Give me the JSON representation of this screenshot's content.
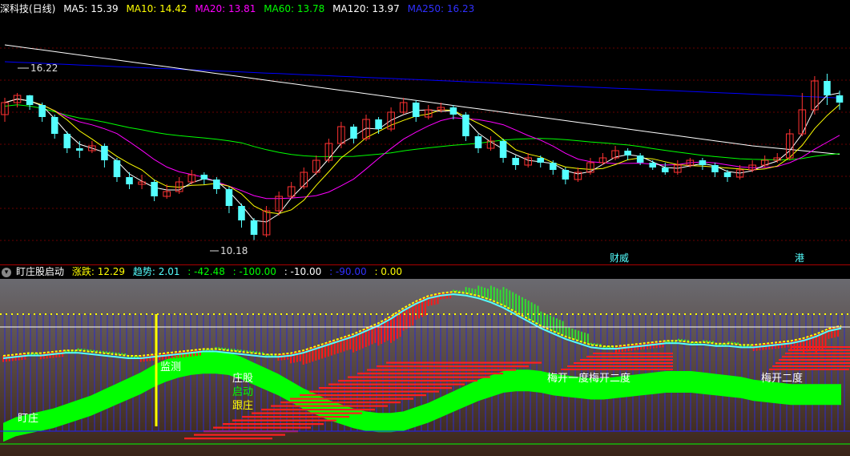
{
  "header_main": {
    "title": "深科技(日线)",
    "ma5": "MA5: 15.39",
    "ma10": "MA10: 14.42",
    "ma20": "MA20: 13.81",
    "ma60": "MA60: 13.78",
    "ma120": "MA120: 13.97",
    "ma250": "MA250: 16.23"
  },
  "header_sub": {
    "title": "盯庄股启动",
    "zhangdie": "涨跌: 12.29",
    "qushi": "趋势: 2.01",
    "v1": ": -42.48",
    "v2": ": -100.00",
    "v3": ": -10.00",
    "v4": ": -90.00",
    "v5": ": 0.00"
  },
  "colors": {
    "ma5": "#ffffff",
    "ma10": "#ffff00",
    "ma20": "#ff00ff",
    "ma60": "#00ff00",
    "ma120": "#ffffff",
    "ma250": "#0000ff",
    "up": "#ff3232",
    "down": "#54ffff"
  },
  "chart_data": [
    {
      "type": "candlestick",
      "high_label": "16.22",
      "low_label": "10.18",
      "ylim": [
        9.5,
        19.5
      ],
      "events": [
        "财威",
        "港"
      ],
      "candles": [
        [
          15.4,
          15.9,
          15.1,
          16.1
        ],
        [
          15.9,
          16.2,
          15.7,
          16.3
        ],
        [
          16.2,
          15.8,
          15.6,
          16.22
        ],
        [
          15.8,
          15.3,
          15.1,
          15.9
        ],
        [
          15.3,
          14.6,
          14.4,
          15.4
        ],
        [
          14.6,
          14.0,
          13.8,
          14.7
        ],
        [
          14.0,
          13.9,
          13.6,
          14.3
        ],
        [
          13.9,
          14.1,
          13.8,
          14.3
        ],
        [
          14.1,
          13.5,
          13.2,
          14.2
        ],
        [
          13.5,
          12.8,
          12.6,
          13.6
        ],
        [
          12.8,
          12.5,
          12.3,
          13.0
        ],
        [
          12.5,
          12.6,
          12.3,
          12.9
        ],
        [
          12.6,
          12.0,
          11.8,
          12.7
        ],
        [
          12.0,
          12.2,
          11.9,
          12.5
        ],
        [
          12.2,
          12.6,
          12.1,
          12.8
        ],
        [
          12.6,
          12.9,
          12.5,
          13.1
        ],
        [
          12.9,
          12.7,
          12.5,
          13.0
        ],
        [
          12.7,
          12.3,
          12.1,
          12.8
        ],
        [
          12.3,
          11.6,
          11.3,
          12.4
        ],
        [
          11.6,
          11.0,
          10.7,
          11.7
        ],
        [
          11.0,
          10.4,
          10.18,
          11.1
        ],
        [
          10.4,
          11.4,
          10.3,
          11.6
        ],
        [
          11.4,
          12.0,
          11.2,
          12.2
        ],
        [
          12.0,
          12.4,
          11.9,
          12.6
        ],
        [
          12.4,
          13.0,
          12.3,
          13.2
        ],
        [
          13.0,
          13.5,
          12.9,
          13.7
        ],
        [
          13.5,
          14.2,
          13.4,
          14.4
        ],
        [
          14.2,
          14.9,
          14.0,
          15.1
        ],
        [
          14.9,
          14.4,
          14.2,
          15.0
        ],
        [
          14.4,
          15.2,
          14.3,
          15.4
        ],
        [
          15.2,
          14.8,
          14.6,
          15.3
        ],
        [
          14.8,
          15.5,
          14.7,
          15.7
        ],
        [
          15.5,
          15.9,
          15.4,
          16.1
        ],
        [
          15.9,
          15.3,
          15.1,
          16.0
        ],
        [
          15.3,
          15.6,
          15.2,
          15.8
        ],
        [
          15.6,
          15.7,
          15.5,
          15.9
        ],
        [
          15.7,
          15.4,
          15.2,
          15.8
        ],
        [
          15.4,
          14.5,
          14.3,
          15.5
        ],
        [
          14.5,
          14.0,
          13.8,
          14.6
        ],
        [
          14.0,
          14.3,
          13.9,
          14.5
        ],
        [
          14.3,
          13.6,
          13.4,
          14.4
        ],
        [
          13.6,
          13.3,
          13.1,
          13.7
        ],
        [
          13.3,
          13.6,
          13.2,
          13.8
        ],
        [
          13.6,
          13.4,
          13.2,
          13.7
        ],
        [
          13.4,
          13.1,
          12.9,
          13.5
        ],
        [
          13.1,
          12.7,
          12.5,
          13.2
        ],
        [
          12.7,
          13.0,
          12.6,
          13.2
        ],
        [
          13.0,
          13.4,
          12.9,
          13.6
        ],
        [
          13.4,
          13.6,
          13.3,
          13.8
        ],
        [
          13.6,
          13.9,
          13.5,
          14.1
        ],
        [
          13.9,
          13.7,
          13.5,
          14.0
        ],
        [
          13.7,
          13.4,
          13.3,
          13.8
        ],
        [
          13.4,
          13.2,
          13.1,
          13.5
        ],
        [
          13.2,
          13.0,
          12.9,
          13.4
        ],
        [
          13.0,
          13.3,
          12.9,
          13.5
        ],
        [
          13.3,
          13.5,
          13.2,
          13.6
        ],
        [
          13.5,
          13.3,
          13.1,
          13.6
        ],
        [
          13.3,
          13.0,
          12.8,
          13.4
        ],
        [
          13.0,
          12.8,
          12.6,
          13.1
        ],
        [
          12.8,
          13.1,
          12.7,
          13.3
        ],
        [
          13.1,
          13.3,
          13.0,
          13.5
        ],
        [
          13.3,
          13.5,
          13.2,
          13.7
        ],
        [
          13.5,
          13.6,
          13.4,
          13.8
        ],
        [
          13.6,
          14.6,
          13.5,
          14.8
        ],
        [
          14.6,
          15.6,
          14.5,
          16.3
        ],
        [
          15.6,
          16.8,
          15.4,
          17.0
        ],
        [
          16.8,
          16.2,
          15.8,
          17.1
        ],
        [
          16.2,
          15.9,
          15.6,
          16.4
        ]
      ]
    },
    {
      "type": "indicator",
      "labels": [
        "盯庄",
        "监测",
        "庄股",
        "启动",
        "跟庄",
        "梅开一度梅开二度",
        "梅开二度"
      ],
      "trend": [
        0.2,
        0.21,
        0.22,
        0.22,
        0.23,
        0.24,
        0.24,
        0.23,
        0.22,
        0.21,
        0.2,
        0.2,
        0.21,
        0.22,
        0.23,
        0.24,
        0.25,
        0.25,
        0.24,
        0.23,
        0.22,
        0.21,
        0.21,
        0.22,
        0.24,
        0.27,
        0.3,
        0.33,
        0.36,
        0.4,
        0.44,
        0.49,
        0.55,
        0.6,
        0.64,
        0.66,
        0.67,
        0.66,
        0.64,
        0.61,
        0.57,
        0.52,
        0.47,
        0.42,
        0.38,
        0.34,
        0.31,
        0.28,
        0.27,
        0.27,
        0.28,
        0.29,
        0.3,
        0.31,
        0.31,
        0.3,
        0.3,
        0.29,
        0.29,
        0.28,
        0.28,
        0.29,
        0.3,
        0.31,
        0.33,
        0.36,
        0.4,
        0.42
      ],
      "green_band": [
        0.14,
        0.18,
        0.2,
        0.22,
        0.24,
        0.27,
        0.3,
        0.33,
        0.37,
        0.41,
        0.45,
        0.49,
        0.54,
        0.58,
        0.61,
        0.63,
        0.64,
        0.64,
        0.63,
        0.6,
        0.56,
        0.52,
        0.48,
        0.43,
        0.38,
        0.34,
        0.3,
        0.27,
        0.24,
        0.22,
        0.21,
        0.21,
        0.22,
        0.25,
        0.28,
        0.32,
        0.36,
        0.4,
        0.44,
        0.47,
        0.5,
        0.51,
        0.51,
        0.5,
        0.48,
        0.47,
        0.46,
        0.45,
        0.45,
        0.46,
        0.47,
        0.48,
        0.49,
        0.5,
        0.5,
        0.5,
        0.49,
        0.48,
        0.47,
        0.46,
        0.44,
        0.43,
        0.42,
        0.41,
        0.41,
        0.41,
        0.41,
        0.41
      ]
    }
  ]
}
